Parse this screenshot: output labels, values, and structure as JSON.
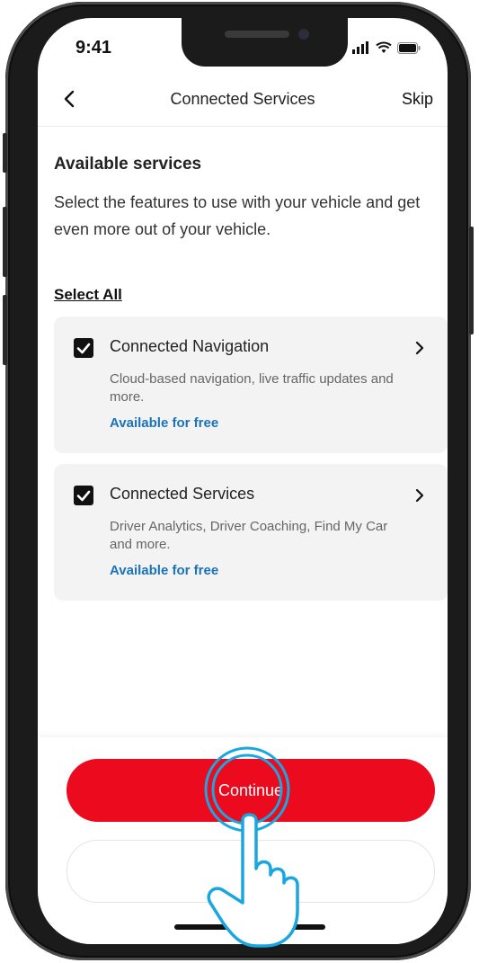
{
  "status": {
    "time": "9:41"
  },
  "header": {
    "title": "Connected Services",
    "skip_label": "Skip"
  },
  "content": {
    "title": "Available services",
    "description": "Select the features to use with your vehicle and get even more out of your vehicle.",
    "select_all": "Select All"
  },
  "services": [
    {
      "name": "Connected Navigation",
      "description": "Cloud-based navigation, live traffic updates and more.",
      "price": "Available for free",
      "checked": true
    },
    {
      "name": "Connected Services",
      "description": "Driver Analytics, Driver Coaching, Find My Car and more.",
      "price": "Available for free",
      "checked": true
    }
  ],
  "footer": {
    "continue_label": "Continue"
  },
  "colors": {
    "primary": "#eb0a1e",
    "link": "#1a73b8",
    "card": "#f3f3f3",
    "tap": "#1aa7e0"
  }
}
